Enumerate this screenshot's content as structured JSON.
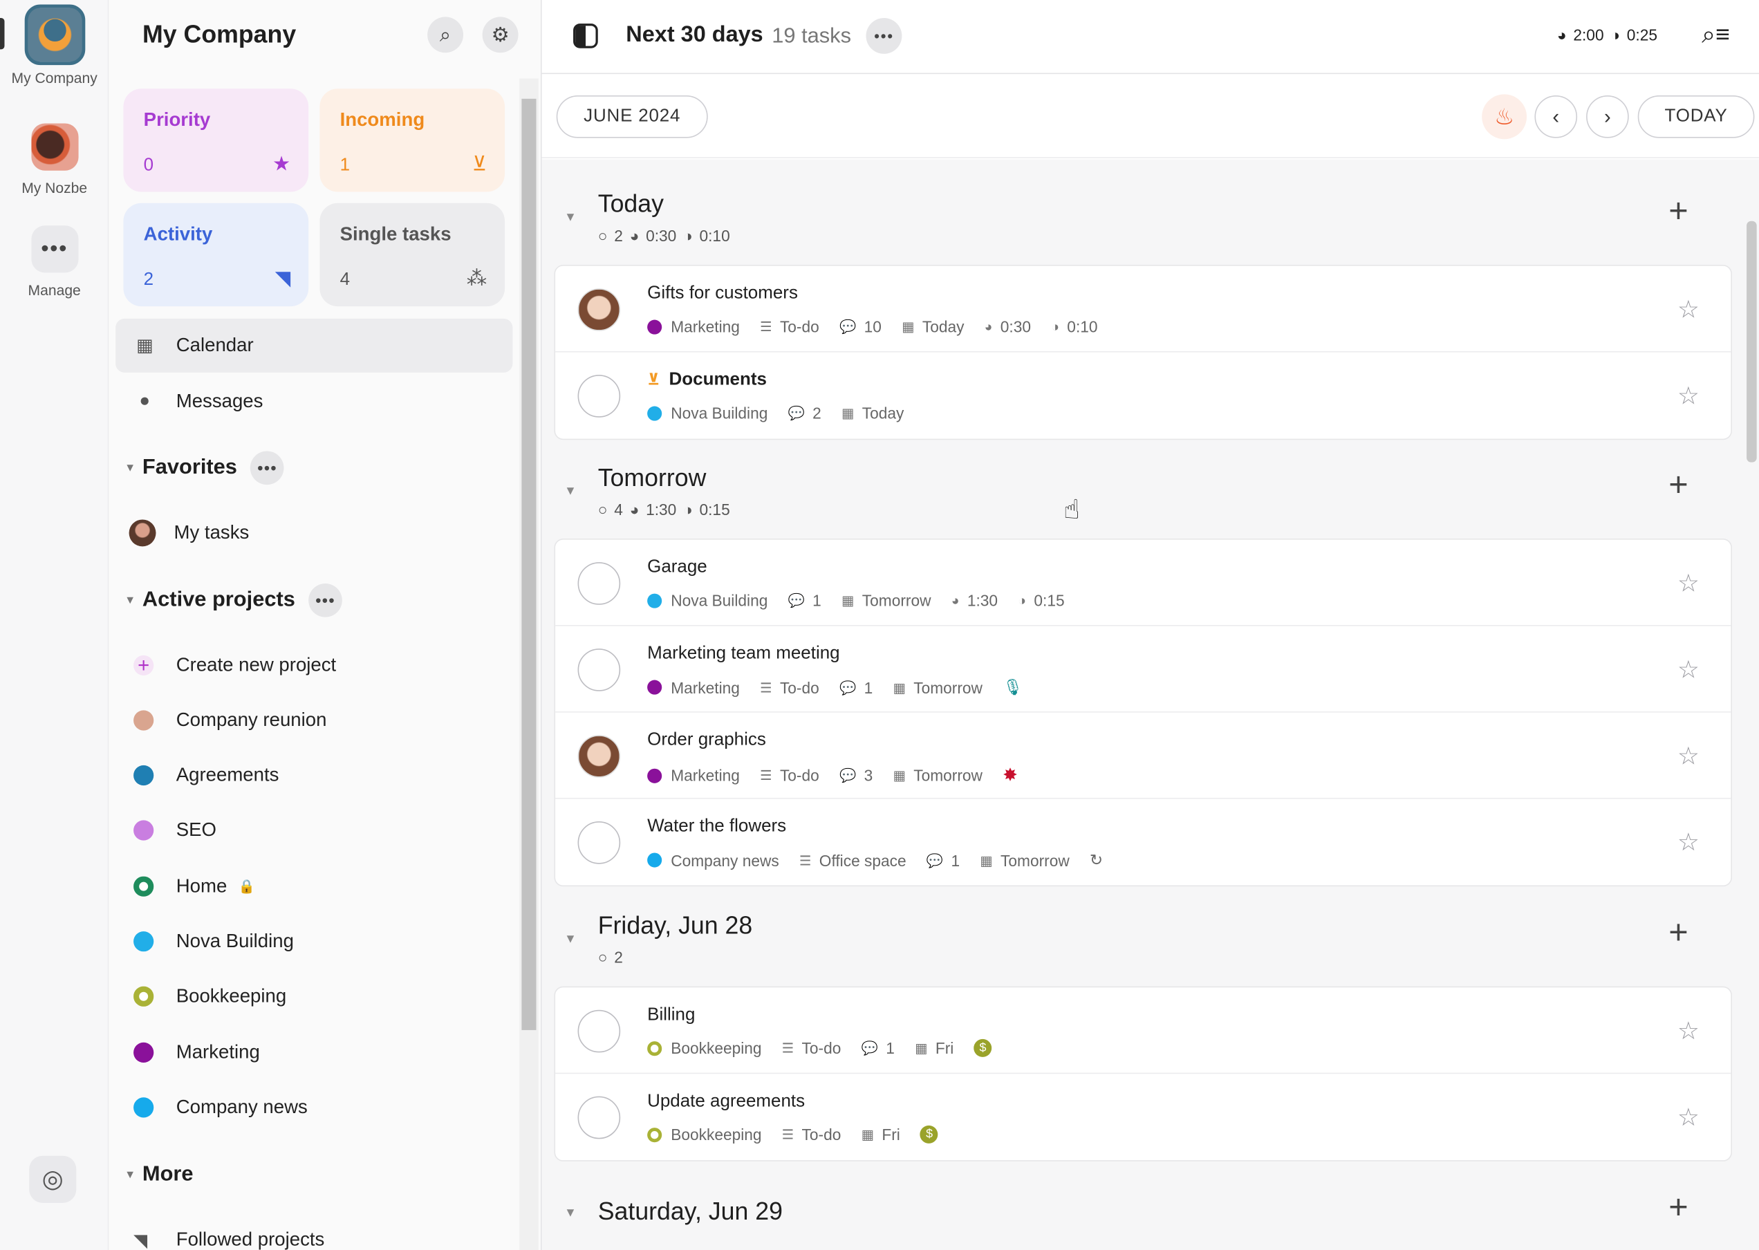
{
  "rail": {
    "company_label": "My Company",
    "nozbe_label": "My Nozbe",
    "manage_label": "Manage"
  },
  "sidebar": {
    "title": "My Company",
    "tiles": {
      "priority": {
        "label": "Priority",
        "count": "0",
        "color": "#a63bd1",
        "bg": "#f7e8f7"
      },
      "incoming": {
        "label": "Incoming",
        "count": "1",
        "color": "#ef8a1c",
        "bg": "#fdf0e6"
      },
      "activity": {
        "label": "Activity",
        "count": "2",
        "color": "#3b63d8",
        "bg": "#e8eefb"
      },
      "single": {
        "label": "Single tasks",
        "count": "4",
        "color": "#555555",
        "bg": "#ececee"
      }
    },
    "calendar": "Calendar",
    "messages": "Messages",
    "favorites": {
      "title": "Favorites",
      "items": [
        "My tasks"
      ]
    },
    "active_projects": {
      "title": "Active projects",
      "create": "Create new project",
      "items": [
        {
          "name": "Company reunion",
          "color": "#d9a58f"
        },
        {
          "name": "Agreements",
          "color": "#1f7fb3"
        },
        {
          "name": "SEO",
          "color": "#c97ee0"
        },
        {
          "name": "Home",
          "color": "#1e8c5c"
        },
        {
          "name": "Nova Building",
          "color": "#21aee8"
        },
        {
          "name": "Bookkeeping",
          "color": "#a9b236"
        },
        {
          "name": "Marketing",
          "color": "#8a119a"
        },
        {
          "name": "Company news",
          "color": "#16aaeb"
        }
      ]
    },
    "more": "More",
    "followed": "Followed projects"
  },
  "header": {
    "title": "Next 30 days",
    "count": "19 tasks",
    "time_total": "2:00",
    "time_spent": "0:25"
  },
  "toolbar": {
    "month": "JUNE 2024",
    "today": "TODAY"
  },
  "groups": {
    "today": {
      "title": "Today",
      "count": "2",
      "time": "0:30",
      "spent": "0:10"
    },
    "tomorrow": {
      "title": "Tomorrow",
      "count": "4",
      "time": "1:30",
      "spent": "0:15"
    },
    "friday": {
      "title": "Friday, Jun 28",
      "count": "2"
    },
    "saturday": {
      "title": "Saturday, Jun 29"
    }
  },
  "tasks": {
    "gifts": {
      "name": "Gifts for customers",
      "project": "Marketing",
      "section": "To-do",
      "comments": "10",
      "due": "Today",
      "time": "0:30",
      "spent": "0:10"
    },
    "documents": {
      "name": "Documents",
      "project": "Nova Building",
      "comments": "2",
      "due": "Today"
    },
    "garage": {
      "name": "Garage",
      "project": "Nova Building",
      "comments": "1",
      "due": "Tomorrow",
      "time": "1:30",
      "spent": "0:15"
    },
    "meeting": {
      "name": "Marketing team meeting",
      "project": "Marketing",
      "section": "To-do",
      "comments": "1",
      "due": "Tomorrow"
    },
    "graphics": {
      "name": "Order graphics",
      "project": "Marketing",
      "section": "To-do",
      "comments": "3",
      "due": "Tomorrow"
    },
    "flowers": {
      "name": "Water the flowers",
      "project": "Company news",
      "section": "Office space",
      "comments": "1",
      "due": "Tomorrow"
    },
    "billing": {
      "name": "Billing",
      "project": "Bookkeeping",
      "section": "To-do",
      "comments": "1",
      "due": "Fri"
    },
    "agreements": {
      "name": "Update agreements",
      "project": "Bookkeeping",
      "section": "To-do",
      "due": "Fri"
    }
  }
}
